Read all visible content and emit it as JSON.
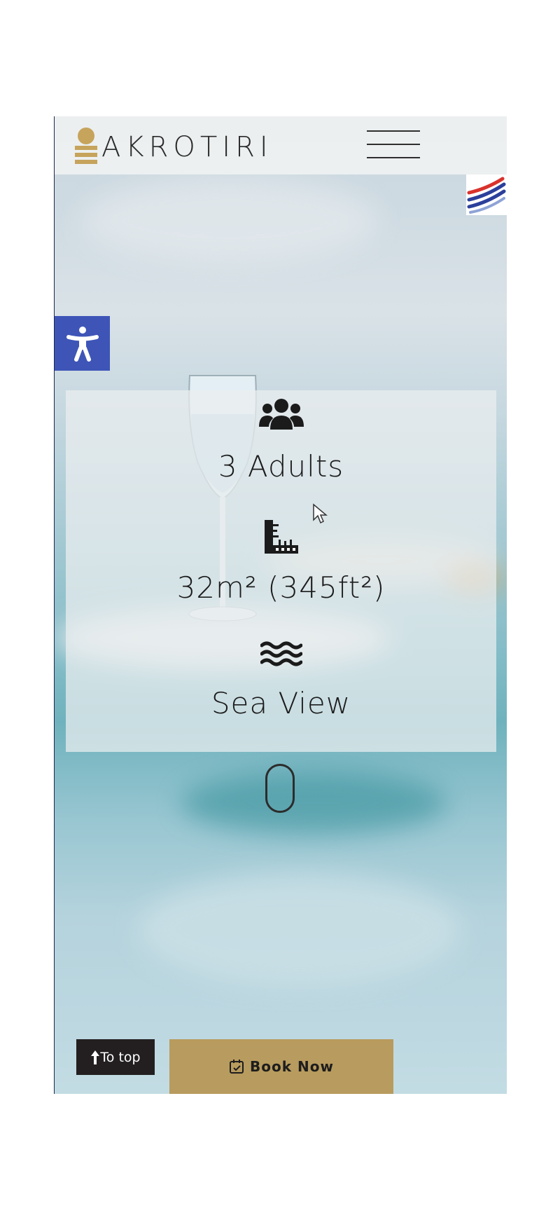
{
  "brand": {
    "name": "AKROTIRI",
    "accent": "#b89b5e"
  },
  "header": {
    "menu_icon": "hamburger-menu-icon",
    "language_icon": "greek-flag-icon"
  },
  "accessibility": {
    "icon": "accessibility-person-icon",
    "color": "#3e55b7"
  },
  "features": [
    {
      "icon": "guests-group-icon",
      "label": "3 Adults"
    },
    {
      "icon": "ruler-area-icon",
      "label": "32m² (345ft²)"
    },
    {
      "icon": "waves-icon",
      "label": "Sea View"
    }
  ],
  "scroll_indicator": {
    "icon": "mouse-scroll-icon"
  },
  "footer": {
    "to_top_label": "To top",
    "to_top_icon": "arrow-up-icon",
    "book_label": "Book Now",
    "book_icon": "calendar-check-icon"
  }
}
